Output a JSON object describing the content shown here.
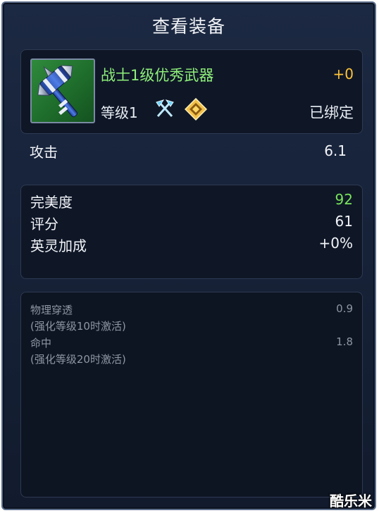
{
  "window": {
    "title": "查看装备"
  },
  "item": {
    "name": "战士1级优秀武器",
    "enhance": "+0",
    "level": "等级1",
    "bind_status": "已绑定",
    "icon": "hammer-weapon-icon",
    "class_icon": "crossed-axes-icon",
    "quality_icon": "gold-diamond-icon"
  },
  "attack": {
    "label": "攻击",
    "value": "6.1"
  },
  "stats": [
    {
      "label": "完美度",
      "value": "92",
      "color": "#79e35a"
    },
    {
      "label": "评分",
      "value": "61"
    },
    {
      "label": "英灵加成",
      "value": "+0%"
    }
  ],
  "bonuses": [
    {
      "name": "物理穿透",
      "value": "0.9",
      "condition": "(强化等级10时激活)"
    },
    {
      "name": "命中",
      "value": "1.8",
      "condition": "(强化等级20时激活)"
    }
  ],
  "watermark": "酷乐米",
  "colors": {
    "item_name": "#8ff07a",
    "enhance": "#ffc338",
    "muted": "#8e96a4"
  }
}
